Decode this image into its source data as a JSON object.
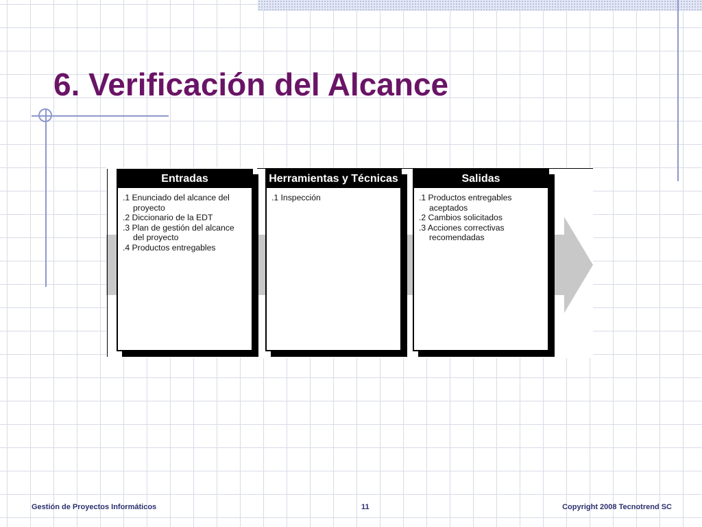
{
  "slide": {
    "title": "6. Verificación del Alcance"
  },
  "diagram": {
    "panels": [
      {
        "header": "Entradas",
        "items": [
          ".1 Enunciado del alcance del proyecto",
          ".2 Diccionario de la EDT",
          ".3 Plan de gestión del alcance del proyecto",
          ".4 Productos entregables"
        ]
      },
      {
        "header": "Herramientas y Técnicas",
        "items": [
          ".1 Inspección"
        ]
      },
      {
        "header": "Salidas",
        "items": [
          ".1 Productos entregables aceptados",
          ".2 Cambios solicitados",
          ".3 Acciones correctivas recomendadas"
        ]
      }
    ],
    "colors": {
      "arrow": "#c8c8c8",
      "header_bg": "#000000",
      "header_text": "#ffffff"
    }
  },
  "footer": {
    "left": "Gestión de Proyectos Informáticos",
    "page_number": "11",
    "right": "Copyright  2008 Tecnotrend SC"
  },
  "theme": {
    "title_color": "#6a1466",
    "accent_line": "#8d98cc",
    "footer_color": "#2b2f6e"
  }
}
